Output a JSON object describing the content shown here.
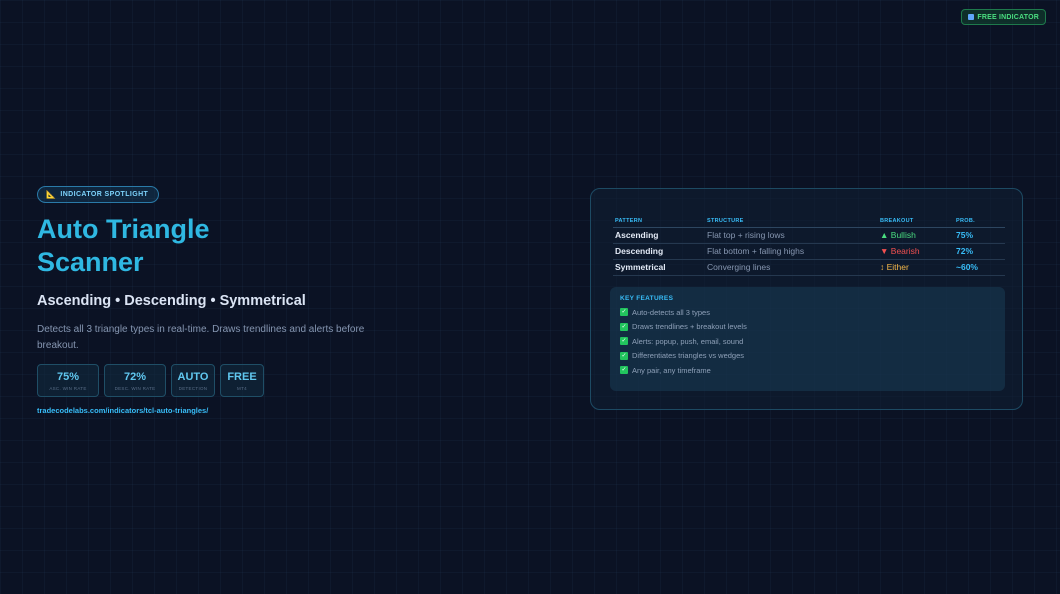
{
  "badge": {
    "label": "FREE INDICATOR"
  },
  "spotlight": {
    "label": "INDICATOR SPOTLIGHT"
  },
  "title": {
    "line1": "Auto Triangle",
    "line2": "Scanner"
  },
  "subtitle": "Ascending • Descending • Symmetrical",
  "description": "Detects all 3 triangle types in real-time. Draws trendlines and alerts before breakout.",
  "stats": [
    {
      "value": "75%",
      "label": "ASC. WIN RATE"
    },
    {
      "value": "72%",
      "label": "DESC. WIN RATE"
    },
    {
      "value": "AUTO",
      "label": "DETECTION"
    },
    {
      "value": "FREE",
      "label": "MT4"
    }
  ],
  "link": "tradecodelabs.com/indicators/tcl-auto-triangles/",
  "table": {
    "headers": [
      "PATTERN",
      "STRUCTURE",
      "BREAKOUT",
      "PROB."
    ],
    "rows": [
      {
        "pattern": "Ascending",
        "structure": "Flat top + rising lows",
        "breakout": "▲ Bullish",
        "prob": "75%"
      },
      {
        "pattern": "Descending",
        "structure": "Flat bottom + falling highs",
        "breakout": "▼ Bearish",
        "prob": "72%"
      },
      {
        "pattern": "Symmetrical",
        "structure": "Converging lines",
        "breakout": "↕ Either",
        "prob": "~60%"
      }
    ]
  },
  "features": {
    "heading": "KEY FEATURES",
    "items": [
      "Auto-detects all 3 types",
      "Draws trendlines + breakout levels",
      "Alerts: popup, push, email, sound",
      "Differentiates triangles vs wedges",
      "Any pair, any timeframe"
    ],
    "check_icon": "✓"
  },
  "colors": {
    "accent": "#38bdf8",
    "bullish": "#4ade80",
    "bearish": "#f25050",
    "either": "#f5b84a",
    "background": "#0b1224"
  }
}
